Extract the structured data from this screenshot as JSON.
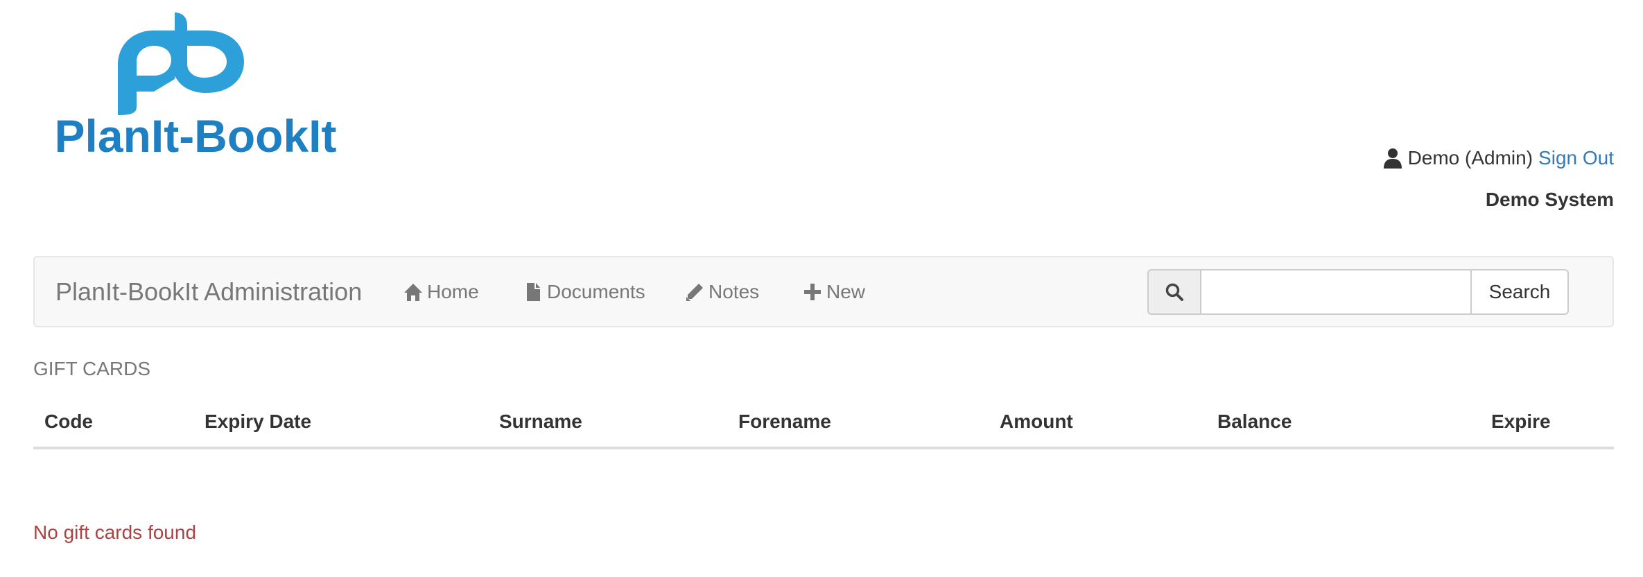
{
  "header": {
    "logo": {
      "mark_text": "pb",
      "wordmark": "PlanIt-BookIt",
      "colors": {
        "mark": "#2d9fd9",
        "wordmark": "#1e7fc2"
      }
    },
    "user": {
      "icon": "user-icon",
      "name": "Demo (Admin)",
      "sign_out_label": "Sign Out"
    },
    "system_name": "Demo System"
  },
  "navbar": {
    "brand": "PlanIt-BookIt Administration",
    "items": [
      {
        "label": "Home",
        "icon": "home-icon"
      },
      {
        "label": "Documents",
        "icon": "document-icon"
      },
      {
        "label": "Notes",
        "icon": "pencil-icon"
      },
      {
        "label": "New",
        "icon": "plus-icon"
      }
    ],
    "search": {
      "icon": "search-icon",
      "value": "",
      "placeholder": "",
      "button_label": "Search"
    }
  },
  "main": {
    "section_title": "GIFT CARDS",
    "table": {
      "columns": [
        "Code",
        "Expiry Date",
        "Surname",
        "Forename",
        "Amount",
        "Balance",
        "Expire"
      ],
      "rows": []
    },
    "empty_message": "No gift cards found"
  },
  "colors": {
    "link": "#337ab7",
    "error_text": "#a94442",
    "navbar_bg": "#f8f8f8",
    "muted_text": "#777777"
  }
}
